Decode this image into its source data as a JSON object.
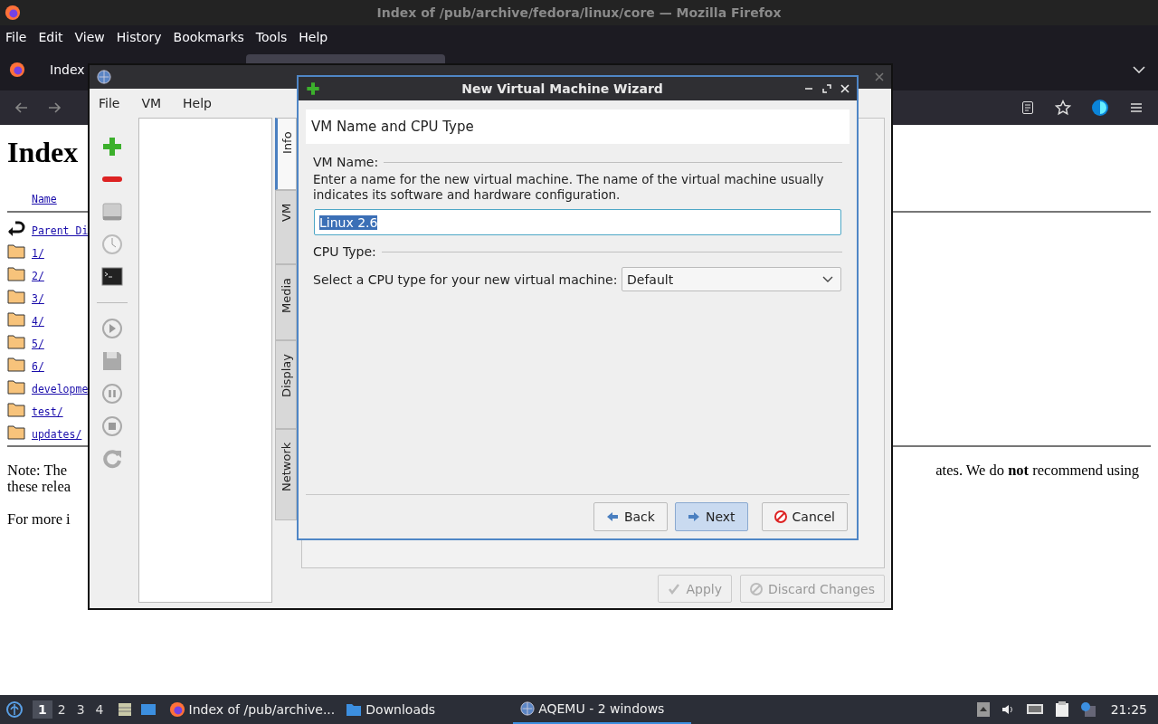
{
  "browser": {
    "title": "Index of /pub/archive/fedora/linux/core — Mozilla Firefox",
    "menu": [
      "File",
      "Edit",
      "View",
      "History",
      "Bookmarks",
      "Tools",
      "Help"
    ],
    "tab": {
      "label": "Index"
    },
    "page": {
      "heading": "Index",
      "column": "Name",
      "entries": [
        {
          "kind": "parent",
          "label": "Parent Di"
        },
        {
          "kind": "folder",
          "label": "1/"
        },
        {
          "kind": "folder",
          "label": "2/"
        },
        {
          "kind": "folder",
          "label": "3/"
        },
        {
          "kind": "folder",
          "label": "4/"
        },
        {
          "kind": "folder",
          "label": "5/"
        },
        {
          "kind": "folder",
          "label": "6/"
        },
        {
          "kind": "folder",
          "label": "developme"
        },
        {
          "kind": "folder",
          "label": "test/"
        },
        {
          "kind": "folder",
          "label": "updates/"
        }
      ],
      "note_left": [
        "Note: The",
        "these relea"
      ],
      "note_right": "ates. We do **not** recommend using",
      "more": "For more i"
    }
  },
  "aqemu": {
    "menu": [
      "File",
      "VM",
      "Help"
    ],
    "tabs": [
      {
        "label": "Info",
        "selected": true
      },
      {
        "label": "VM",
        "selected": false
      },
      {
        "label": "Media",
        "selected": false
      },
      {
        "label": "Display",
        "selected": false
      },
      {
        "label": "Network",
        "selected": false
      }
    ],
    "buttons": [
      {
        "kind": "apply",
        "label": "Apply",
        "disabled": true
      },
      {
        "kind": "discard",
        "label": "Discard Changes",
        "disabled": true
      }
    ]
  },
  "wizard": {
    "title": "New Virtual Machine Wizard",
    "page_title": "VM Name and CPU Type",
    "name_group": "VM Name:",
    "name_hint": "Enter a name for the new virtual machine. The name of the virtual machine usually indicates its software and hardware configuration.",
    "name_value": "Linux 2.6",
    "cpu_group": "CPU Type:",
    "cpu_label": "Select a CPU type for your new virtual machine:",
    "cpu_value": "Default",
    "buttons": [
      {
        "kind": "back",
        "label": "Back",
        "default": false
      },
      {
        "kind": "next",
        "label": "Next",
        "default": true
      },
      {
        "kind": "cancel",
        "label": "Cancel",
        "default": false
      }
    ]
  },
  "taskbar": {
    "workspaces": [
      {
        "label": "1",
        "selected": true
      },
      {
        "label": "2",
        "selected": false
      },
      {
        "label": "3",
        "selected": false
      },
      {
        "label": "4",
        "selected": false
      }
    ],
    "tasks": [
      {
        "kind": "firefox",
        "label": "Index of /pub/archive...",
        "selected": false
      },
      {
        "kind": "folder",
        "label": "Downloads",
        "selected": false
      },
      {
        "kind": "aqemu",
        "label": "AQEMU - 2 windows",
        "selected": true
      }
    ],
    "clock": "21:25"
  }
}
